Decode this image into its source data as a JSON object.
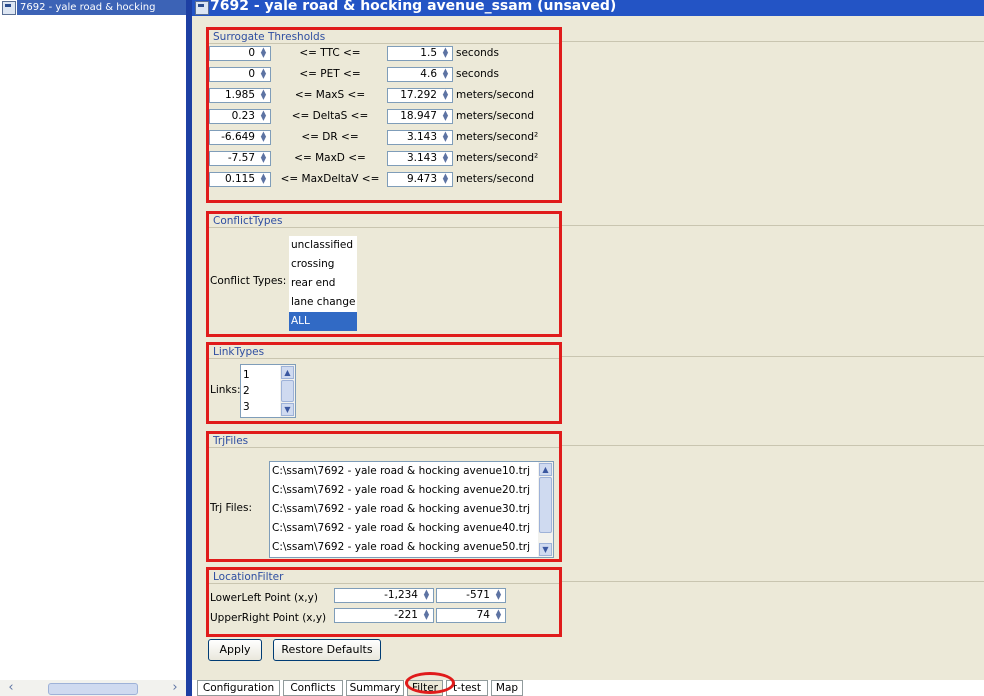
{
  "left_panel": {
    "title": "7692 - yale road & hocking"
  },
  "window": {
    "title": "7692 - yale road & hocking avenue_ssam (unsaved)"
  },
  "thresholds": {
    "title": "Surrogate Thresholds",
    "rows": [
      {
        "min": "0",
        "label": "<= TTC <=",
        "max": "1.5",
        "unit": "seconds"
      },
      {
        "min": "0",
        "label": "<= PET <=",
        "max": "4.6",
        "unit": "seconds"
      },
      {
        "min": "1.985",
        "label": "<= MaxS <=",
        "max": "17.292",
        "unit": "meters/second"
      },
      {
        "min": "0.23",
        "label": "<= DeltaS <=",
        "max": "18.947",
        "unit": "meters/second"
      },
      {
        "min": "-6.649",
        "label": "<= DR <=",
        "max": "3.143",
        "unit": "meters/second²"
      },
      {
        "min": "-7.57",
        "label": "<= MaxD <=",
        "max": "3.143",
        "unit": "meters/second²"
      },
      {
        "min": "0.115",
        "label": "<= MaxDeltaV <=",
        "max": "9.473",
        "unit": "meters/second"
      }
    ]
  },
  "conflict_types": {
    "title": "ConflictTypes",
    "label": "Conflict Types:",
    "options": [
      "unclassified",
      "crossing",
      "rear end",
      "lane change",
      "ALL"
    ],
    "selected": "ALL"
  },
  "link_types": {
    "title": "LinkTypes",
    "label": "Links:",
    "options": [
      "1",
      "2",
      "3"
    ]
  },
  "trj_files": {
    "title": "TrjFiles",
    "label": "Trj Files:",
    "files": [
      "C:\\ssam\\7692 - yale road & hocking avenue10.trj",
      "C:\\ssam\\7692 - yale road & hocking avenue20.trj",
      "C:\\ssam\\7692 - yale road & hocking avenue30.trj",
      "C:\\ssam\\7692 - yale road & hocking avenue40.trj",
      "C:\\ssam\\7692 - yale road & hocking avenue50.trj"
    ]
  },
  "location_filter": {
    "title": "LocationFilter",
    "lower_left": {
      "label": "LowerLeft Point (x,y)",
      "x": "-1,234",
      "y": "-571"
    },
    "upper_right": {
      "label": "UpperRight Point (x,y)",
      "x": "-221",
      "y": "74"
    }
  },
  "buttons": {
    "apply": "Apply",
    "restore": "Restore Defaults"
  },
  "tabs": [
    {
      "label": "Configuration"
    },
    {
      "label": "Conflicts"
    },
    {
      "label": "Summary"
    },
    {
      "label": "Filter",
      "selected": true
    },
    {
      "label": "t-test"
    },
    {
      "label": "Map"
    }
  ],
  "icons": {
    "spinner": "up-down-arrows-icon",
    "scroll_left": "chevron-left-icon",
    "scroll_right": "chevron-right-icon",
    "scroll_up": "chevron-up-icon",
    "scroll_down": "chevron-down-icon",
    "window": "window-icon"
  },
  "colors": {
    "highlight": "#e01b1b",
    "section_title": "#2e4ea1",
    "selection": "#316ac5",
    "title_bar": "#2354c5",
    "panel_bg": "#ece9d8"
  }
}
